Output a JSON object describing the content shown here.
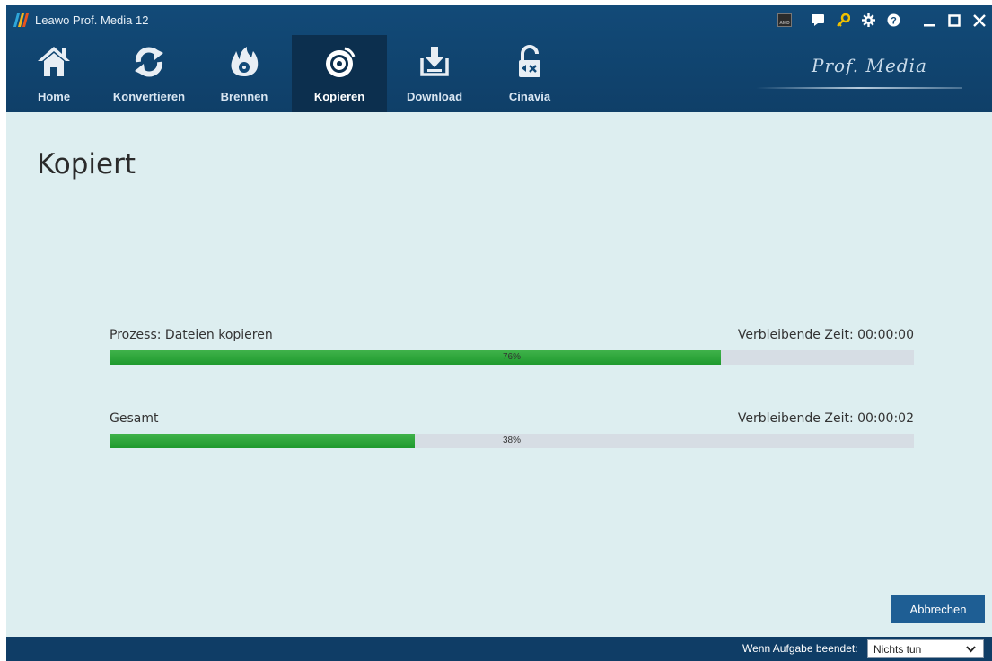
{
  "window": {
    "title": "Leawo Prof. Media 12"
  },
  "titlebar": {
    "icons": [
      "amd-icon",
      "feedback-icon",
      "key-icon",
      "settings-icon",
      "help-icon",
      "minimize-icon",
      "maximize-icon",
      "close-icon"
    ]
  },
  "nav": {
    "items": [
      {
        "label": "Home",
        "icon": "home-icon"
      },
      {
        "label": "Konvertieren",
        "icon": "convert-icon"
      },
      {
        "label": "Brennen",
        "icon": "burn-icon"
      },
      {
        "label": "Kopieren",
        "icon": "copy-disc-icon",
        "active": true
      },
      {
        "label": "Download",
        "icon": "download-icon"
      },
      {
        "label": "Cinavia",
        "icon": "cinavia-unlock-icon"
      }
    ]
  },
  "brand": {
    "text": "Prof. Media"
  },
  "main": {
    "title": "Kopiert",
    "process": {
      "label": "Prozess: Dateien kopieren",
      "time": "Verbleibende Zeit: 00:00:00",
      "percent_text": "76%",
      "value": 76
    },
    "total": {
      "label": "Gesamt",
      "time": "Verbleibende Zeit: 00:00:02",
      "percent_text": "38%",
      "value": 38
    },
    "cancel_label": "Abbrechen"
  },
  "footer": {
    "label": "Wenn Aufgabe beendet:",
    "select_value": "Nichts tun"
  },
  "colors": {
    "accent": "#124a78",
    "progress": "#2aa83a",
    "background": "#ddeef0"
  }
}
